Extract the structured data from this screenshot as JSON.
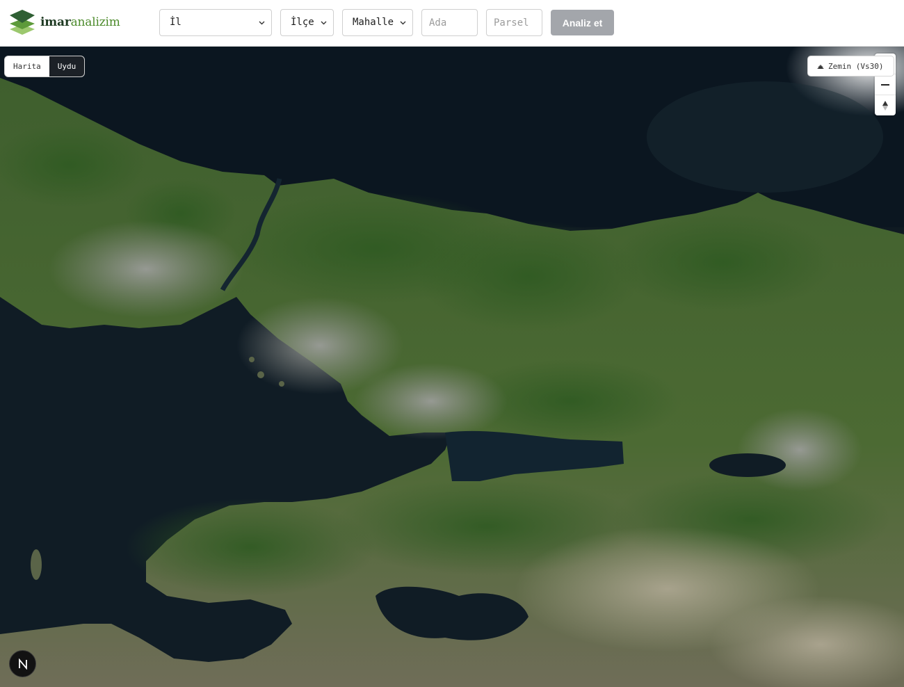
{
  "brand": {
    "name_bold": "imar",
    "name_light": "analizim"
  },
  "filters": {
    "il": {
      "selected": "İl"
    },
    "ilce": {
      "selected": "İlçe"
    },
    "mahalle": {
      "selected": "Mahalle"
    },
    "ada": {
      "placeholder": "Ada",
      "value": ""
    },
    "parsel": {
      "placeholder": "Parsel",
      "value": ""
    },
    "analyze_label": "Analiz et"
  },
  "map": {
    "base_layers": [
      "Harita",
      "Uydu"
    ],
    "active_base_layer": "Uydu",
    "overlay_label": "Zemin (Vs30)",
    "icons": {
      "overlay": "layers-icon",
      "zoom_in": "plus-icon",
      "zoom_out": "minus-icon",
      "compass": "compass-icon",
      "corner_badge": "n-logo-icon"
    }
  },
  "colors": {
    "active_toggle": "#1c2127",
    "analyze_button": "#a3a6ab",
    "logo_dark": "#1e3a22",
    "logo_green": "#4b8a2a"
  }
}
